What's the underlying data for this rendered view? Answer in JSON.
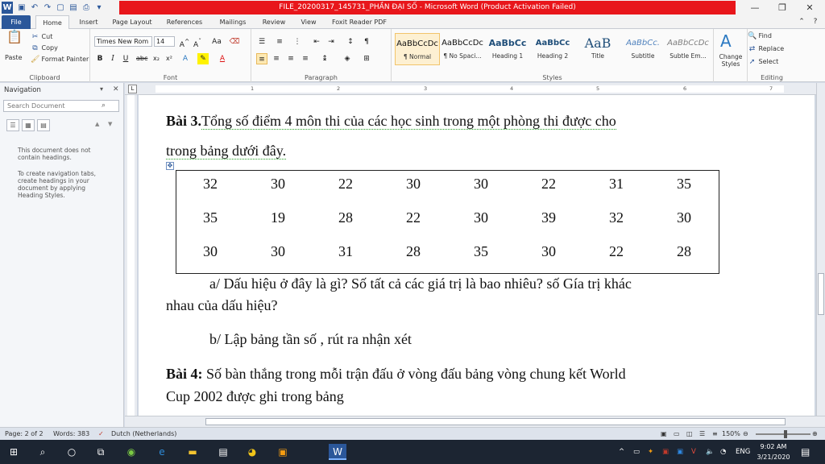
{
  "window": {
    "title": "FILE_20200317_145731_PHẦN ĐẠI SỐ  -  Microsoft Word (Product Activation Failed)",
    "accent": "#2b579a",
    "title_bar_color": "#e8161b"
  },
  "tabs": [
    "File",
    "Home",
    "Insert",
    "Page Layout",
    "References",
    "Mailings",
    "Review",
    "View",
    "Foxit Reader PDF"
  ],
  "ribbon": {
    "clipboard": {
      "paste": "Paste",
      "cut": "Cut",
      "copy": "Copy",
      "format_painter": "Format Painter",
      "label": "Clipboard"
    },
    "font": {
      "name": "Times New Rom",
      "size": "14",
      "label": "Font"
    },
    "paragraph": {
      "label": "Paragraph"
    },
    "styles": {
      "label": "Styles",
      "items": [
        {
          "preview": "AaBbCcDc",
          "name": "¶ Normal"
        },
        {
          "preview": "AaBbCcDc",
          "name": "¶ No Spaci..."
        },
        {
          "preview": "AaBbCc",
          "name": "Heading 1"
        },
        {
          "preview": "AaBbCc",
          "name": "Heading 2"
        },
        {
          "preview": "AaB",
          "name": "Title"
        },
        {
          "preview": "AaBbCc.",
          "name": "Subtitle"
        },
        {
          "preview": "AaBbCcDc",
          "name": "Subtle Em..."
        }
      ],
      "change_styles": "Change Styles"
    },
    "editing": {
      "find": "Find",
      "replace": "Replace",
      "select": "Select",
      "label": "Editing"
    }
  },
  "navigation": {
    "title": "Navigation",
    "search_placeholder": "Search Document",
    "msg1": "This document does not contain headings.",
    "msg2": "To create navigation tabs, create headings in your document by applying Heading Styles."
  },
  "document": {
    "bai3_bold": "Bài 3.",
    "bai3_text": "Tổng số điểm 4 môn thi của các học sinh trong một phòng thi được cho",
    "bai3_text2": "trong bảng dưới đây.",
    "table_rows": [
      [
        "32",
        "30",
        "22",
        "30",
        "30",
        "22",
        "31",
        "35"
      ],
      [
        "35",
        "19",
        "28",
        "22",
        "30",
        "39",
        "32",
        "30"
      ],
      [
        "30",
        "30",
        "31",
        "28",
        "35",
        "30",
        "22",
        "28"
      ]
    ],
    "qa_line1": "a/ Dấu hiệu ở đây là gì? Số tất cả các giá trị là bao nhiêu? số Gía trị khác",
    "qa_line2": "nhau của dấu hiệu?",
    "qb": "b/ Lập bảng tần số ,  rút ra nhận xét",
    "bai4_bold": "Bài 4:",
    "bai4_text": " Số bàn thắng trong mỗi trận đấu ở vòng đấu bảng vòng chung kết World",
    "bai4_text2": "Cup 2002 được ghi trong bảng"
  },
  "ruler_ticks": [
    "1",
    "2",
    "3",
    "4",
    "5",
    "6",
    "7"
  ],
  "status": {
    "page": "Page: 2 of 2",
    "words": "Words: 383",
    "language": "Dutch (Netherlands)",
    "zoom": "150%"
  },
  "taskbar": {
    "language": "ENG",
    "time": "9:02 AM",
    "date": "3/21/2020"
  }
}
